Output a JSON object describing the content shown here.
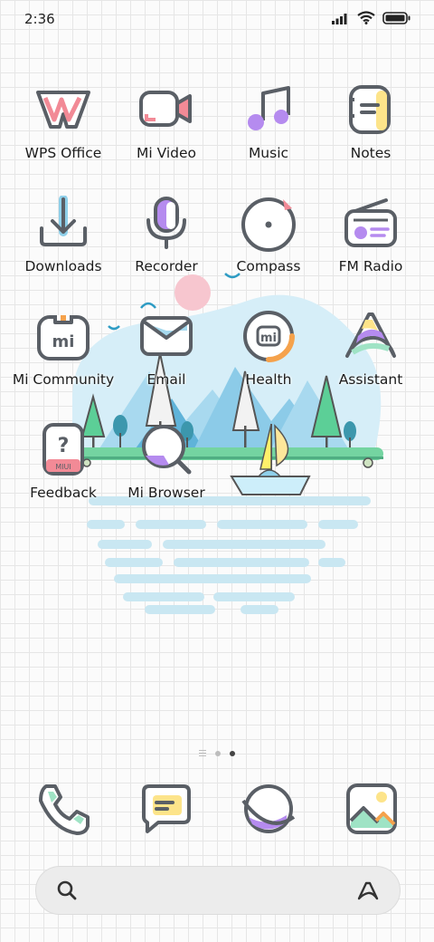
{
  "status_bar": {
    "time": "2:36"
  },
  "apps": [
    {
      "label": "WPS Office",
      "icon": "wps-office-icon"
    },
    {
      "label": "Mi Video",
      "icon": "video-camera-icon"
    },
    {
      "label": "Music",
      "icon": "music-note-icon"
    },
    {
      "label": "Notes",
      "icon": "notes-icon"
    },
    {
      "label": "Downloads",
      "icon": "download-icon"
    },
    {
      "label": "Recorder",
      "icon": "microphone-icon"
    },
    {
      "label": "Compass",
      "icon": "compass-icon"
    },
    {
      "label": "FM Radio",
      "icon": "radio-icon"
    },
    {
      "label": "Mi Community",
      "icon": "mi-community-icon"
    },
    {
      "label": "Email",
      "icon": "envelope-icon"
    },
    {
      "label": "Health",
      "icon": "health-ring-icon"
    },
    {
      "label": "Assistant",
      "icon": "assistant-icon"
    },
    {
      "label": "Feedback",
      "icon": "feedback-icon"
    },
    {
      "label": "Mi Browser",
      "icon": "browser-icon"
    }
  ],
  "app_icon_text": {
    "mi": "mi",
    "miui": "MIUI",
    "question": "?"
  },
  "page_indicator": {
    "count": 2,
    "active_index": 1
  },
  "dock": [
    {
      "icon": "phone-icon"
    },
    {
      "icon": "messages-icon"
    },
    {
      "icon": "planet-icon"
    },
    {
      "icon": "gallery-icon"
    }
  ],
  "colors": {
    "outline": "#5a5f66",
    "pink": "#f28a96",
    "purple": "#b58bef",
    "yellow": "#fde48a",
    "blue": "#8fd0ea",
    "orange": "#f5a24c",
    "mint": "#9fe3c5"
  }
}
